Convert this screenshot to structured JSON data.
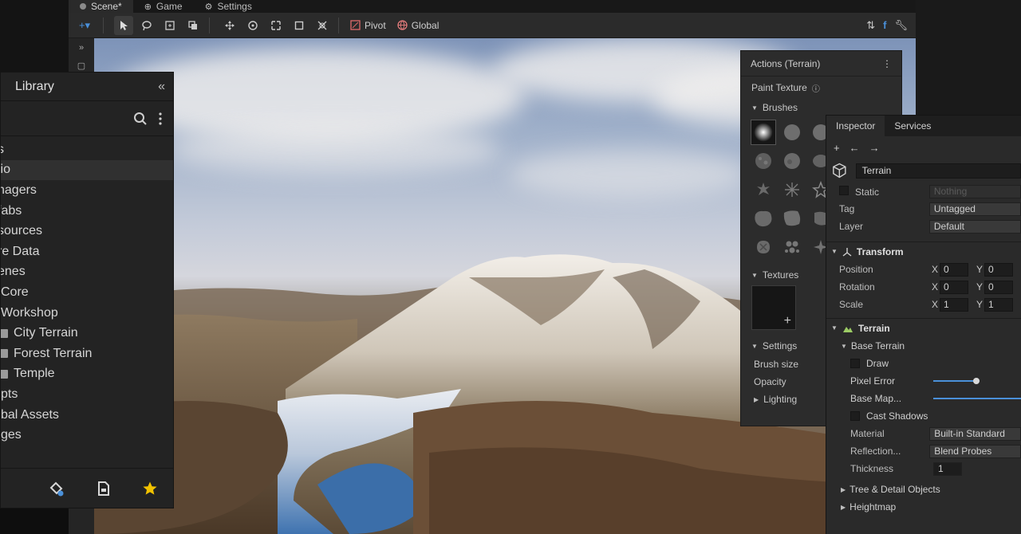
{
  "scene_tabs": [
    {
      "label": "Scene*",
      "icon": "scene-dot-icon"
    },
    {
      "label": "Game",
      "icon": "gamepad-icon"
    },
    {
      "label": "Settings",
      "icon": "gear-icon"
    }
  ],
  "toolbar": {
    "pivot_label": "Pivot",
    "global_label": "Global",
    "tools": [
      "add-icon",
      "select-arrow-icon",
      "lasso-icon",
      "rect-select-icon",
      "duplicate-icon",
      "move-icon",
      "rotate-icon",
      "scale-icon",
      "rect-tool-icon",
      "transform-icon"
    ]
  },
  "library": {
    "title": "Library",
    "items": [
      {
        "label": "s",
        "folder": false
      },
      {
        "label": "lio",
        "folder": false,
        "selected": true
      },
      {
        "label": "nagers",
        "folder": false
      },
      {
        "label": "fabs",
        "folder": false
      },
      {
        "label": "sources",
        "folder": false
      },
      {
        "label": "re Data",
        "folder": false
      },
      {
        "label": "enes",
        "folder": false
      },
      {
        "label": "Core",
        "folder": false
      },
      {
        "label": "Workshop",
        "folder": false
      },
      {
        "label": "City Terrain",
        "folder": true
      },
      {
        "label": "Forest Terrain",
        "folder": true
      },
      {
        "label": "Temple",
        "folder": true
      },
      {
        "label": "pts",
        "folder": false
      },
      {
        "label": "bal Assets",
        "folder": false
      },
      {
        "label": "ges",
        "folder": false
      }
    ],
    "footer_icons": [
      "asset-tag-icon",
      "document-icon",
      "star-icon"
    ]
  },
  "actions_panel": {
    "title": "Actions (Terrain)",
    "paint_texture": "Paint Texture",
    "brushes_label": "Brushes",
    "textures_label": "Textures",
    "settings_label": "Settings",
    "brush_size_label": "Brush size",
    "opacity_label": "Opacity",
    "lighting_label": "Lighting"
  },
  "inspector": {
    "tabs": [
      "Inspector",
      "Services"
    ],
    "object_name": "Terrain",
    "static_label": "Static",
    "static_value": "Nothing",
    "tag_label": "Tag",
    "tag_value": "Untagged",
    "layer_label": "Layer",
    "layer_value": "Default",
    "transform": {
      "title": "Transform",
      "rows": [
        {
          "label": "Position",
          "x": "0",
          "y": "0"
        },
        {
          "label": "Rotation",
          "x": "0",
          "y": "0"
        },
        {
          "label": "Scale",
          "x": "1",
          "y": "1"
        }
      ]
    },
    "terrain": {
      "title": "Terrain",
      "base_terrain": "Base Terrain",
      "draw": "Draw",
      "pixel_error": "Pixel Error",
      "base_map": "Base Map...",
      "cast_shadows": "Cast Shadows",
      "material_label": "Material",
      "material_value": "Built-in Standard",
      "reflection_label": "Reflection...",
      "reflection_value": "Blend Probes",
      "thickness_label": "Thickness",
      "thickness_value": "1",
      "tree_detail": "Tree & Detail Objects",
      "heightmap": "Heightmap"
    }
  },
  "colors": {
    "accent": "#4a90d9",
    "star": "#f2c200",
    "panel": "#2a2a2a"
  }
}
